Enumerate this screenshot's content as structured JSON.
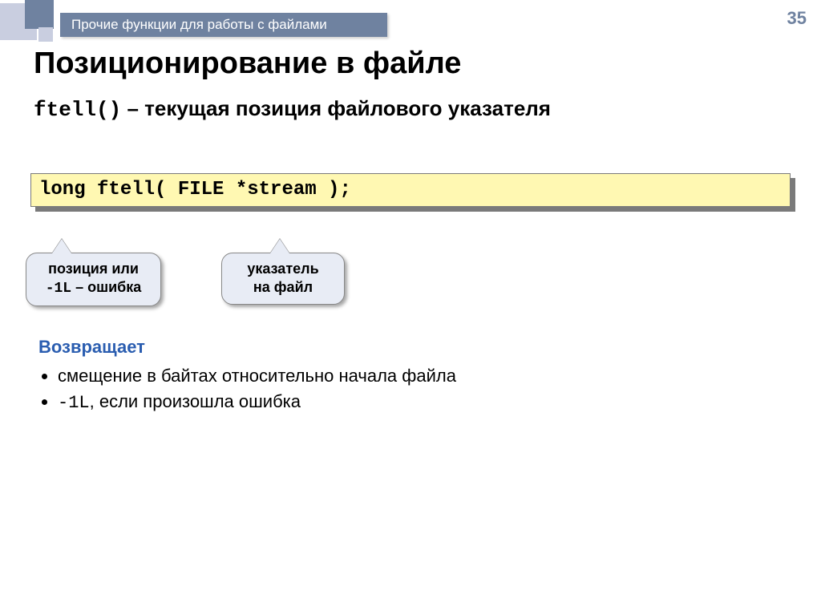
{
  "page_number": "35",
  "header": "Прочие функции для работы с файлами",
  "title": "Позиционирование в файле",
  "subtitle": {
    "func": "ftell()",
    "sep": " – ",
    "desc": "текущая позиция файлового указателя"
  },
  "code": "long ftell( FILE *stream );",
  "callouts": {
    "c1_line1": "позиция или",
    "c1_code": "-1L",
    "c1_rest": " – ошибка",
    "c2_line1": "указатель",
    "c2_line2": "на файл"
  },
  "returns": {
    "heading": "Возвращает",
    "item1": "смещение в байтах относительно начала файла",
    "item2_code": "-1L",
    "item2_rest": ", если произошла ошибка"
  }
}
